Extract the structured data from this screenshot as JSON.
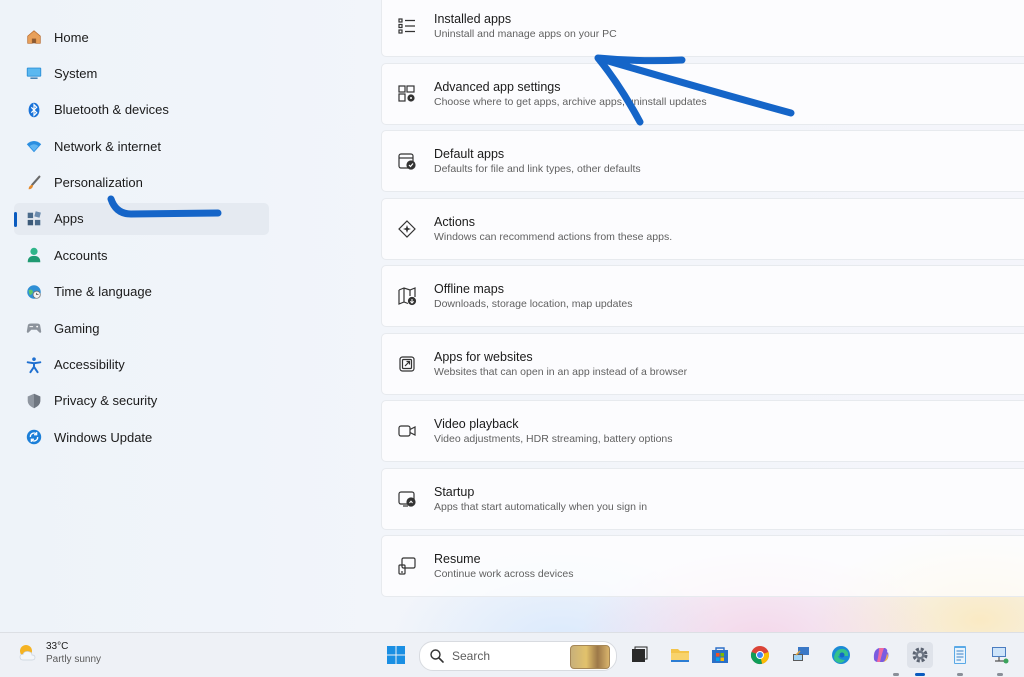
{
  "sidebar": {
    "items": [
      {
        "label": "Home",
        "icon": "home-icon",
        "active": false
      },
      {
        "label": "System",
        "icon": "system-icon",
        "active": false
      },
      {
        "label": "Bluetooth & devices",
        "icon": "bluetooth-icon",
        "active": false
      },
      {
        "label": "Network & internet",
        "icon": "wifi-icon",
        "active": false
      },
      {
        "label": "Personalization",
        "icon": "brush-icon",
        "active": false
      },
      {
        "label": "Apps",
        "icon": "apps-icon",
        "active": true
      },
      {
        "label": "Accounts",
        "icon": "person-icon",
        "active": false
      },
      {
        "label": "Time & language",
        "icon": "globe-clock-icon",
        "active": false
      },
      {
        "label": "Gaming",
        "icon": "gamepad-icon",
        "active": false
      },
      {
        "label": "Accessibility",
        "icon": "accessibility-icon",
        "active": false
      },
      {
        "label": "Privacy & security",
        "icon": "shield-icon",
        "active": false
      },
      {
        "label": "Windows Update",
        "icon": "update-icon",
        "active": false
      }
    ]
  },
  "main": {
    "cards": [
      {
        "title": "Installed apps",
        "subtitle": "Uninstall and manage apps on your PC",
        "icon": "list-icon"
      },
      {
        "title": "Advanced app settings",
        "subtitle": "Choose where to get apps, archive apps, uninstall updates",
        "icon": "app-settings-icon"
      },
      {
        "title": "Default apps",
        "subtitle": "Defaults for file and link types, other defaults",
        "icon": "default-apps-icon"
      },
      {
        "title": "Actions",
        "subtitle": "Windows can recommend actions from these apps.",
        "icon": "actions-icon"
      },
      {
        "title": "Offline maps",
        "subtitle": "Downloads, storage location, map updates",
        "icon": "map-icon"
      },
      {
        "title": "Apps for websites",
        "subtitle": "Websites that can open in an app instead of a browser",
        "icon": "open-external-icon"
      },
      {
        "title": "Video playback",
        "subtitle": "Video adjustments, HDR streaming, battery options",
        "icon": "video-icon"
      },
      {
        "title": "Startup",
        "subtitle": "Apps that start automatically when you sign in",
        "icon": "startup-icon"
      },
      {
        "title": "Resume",
        "subtitle": "Continue work across devices",
        "icon": "resume-icon"
      }
    ]
  },
  "taskbar": {
    "weather": {
      "temp": "33°C",
      "condition": "Partly sunny",
      "icon": "partly-sunny-icon"
    },
    "search": {
      "placeholder": "Search"
    },
    "apps": [
      {
        "name": "start-button",
        "icon": "windows-logo-icon"
      },
      {
        "name": "task-view-button",
        "icon": "task-view-icon"
      },
      {
        "name": "file-explorer-button",
        "icon": "folder-icon"
      },
      {
        "name": "microsoft-store-button",
        "icon": "store-icon"
      },
      {
        "name": "chrome-button",
        "icon": "chrome-icon"
      },
      {
        "name": "remote-desktop-button",
        "icon": "remote-desktop-icon"
      },
      {
        "name": "edge-button",
        "icon": "edge-icon"
      },
      {
        "name": "copilot-button",
        "icon": "copilot-icon"
      },
      {
        "name": "settings-button",
        "icon": "gear-icon"
      },
      {
        "name": "notepad-button",
        "icon": "notepad-icon"
      },
      {
        "name": "network-app-button",
        "icon": "network-pc-icon"
      }
    ]
  },
  "colors": {
    "accent": "#0a5bbf",
    "annotation": "#1565c8"
  }
}
